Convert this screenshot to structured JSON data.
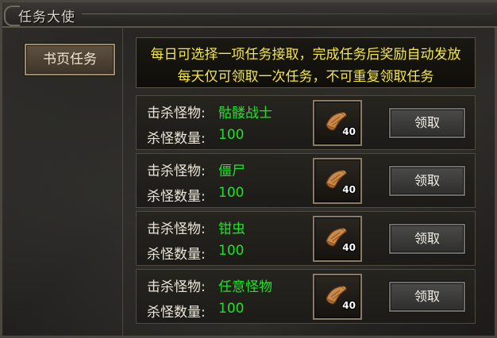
{
  "window": {
    "title": "任务大使"
  },
  "tabs": [
    {
      "label": "书页任务"
    }
  ],
  "notice": {
    "line1": "每日可选择一项任务接取，完成任务后奖励自动发放",
    "line2": "每天仅可领取一次任务，不可重复领取任务"
  },
  "labels": {
    "kill_monster": "击杀怪物:",
    "kill_count": "杀怪数量:"
  },
  "tasks": [
    {
      "monster": "骷髅战士",
      "count": "100",
      "reward_count": "40",
      "claim_label": "领取"
    },
    {
      "monster": "僵尸",
      "count": "100",
      "reward_count": "40",
      "claim_label": "领取"
    },
    {
      "monster": "钳虫",
      "count": "100",
      "reward_count": "40",
      "claim_label": "领取"
    },
    {
      "monster": "任意怪物",
      "count": "100",
      "reward_count": "40",
      "claim_label": "领取"
    }
  ],
  "icons": {
    "title": "ornament-icon",
    "reward": "scroll-icon"
  },
  "colors": {
    "notice_text": "#f4e74a",
    "value_text": "#22e02a",
    "label_text": "#ece7da"
  }
}
